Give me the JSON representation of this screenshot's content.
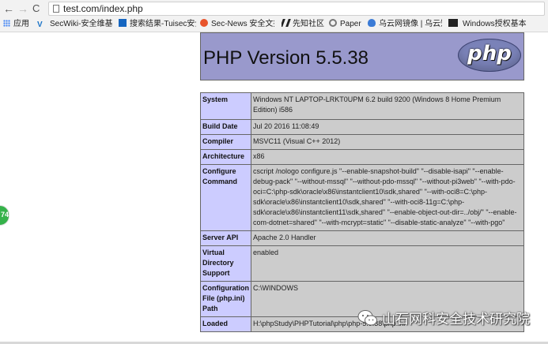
{
  "browser": {
    "url": "test.com/index.php",
    "nav": {
      "back": "←",
      "forward": "→",
      "reload": "C"
    }
  },
  "bookmarks": [
    {
      "label": "应用",
      "icon": "apps-icon",
      "color": "#4285f4"
    },
    {
      "label": "SecWiki-安全维基",
      "icon": "secwiki-icon",
      "color": "#1a73c7"
    },
    {
      "label": "搜索结果-Tuisec安全",
      "icon": "tuisec-icon",
      "color": "#1565c0"
    },
    {
      "label": "Sec-News 安全文摘",
      "icon": "secnews-icon",
      "color": "#e8532b"
    },
    {
      "label": "先知社区",
      "icon": "xianzhi-icon",
      "color": "#222222"
    },
    {
      "label": "Paper",
      "icon": "paper-icon",
      "color": "#666666"
    },
    {
      "label": "乌云网镜像 | 乌云知",
      "icon": "wooyun-icon",
      "color": "#3b7bd6"
    },
    {
      "label": "Windows授权基本",
      "icon": "windows-icon",
      "color": "#222222"
    }
  ],
  "php": {
    "version_title": "PHP Version 5.5.38",
    "logo_text": "php",
    "rows": [
      {
        "key": "System",
        "value": "Windows NT LAPTOP-LRKT0UPM 6.2 build 9200 (Windows 8 Home Premium Edition) i586"
      },
      {
        "key": "Build Date",
        "value": "Jul 20 2016 11:08:49"
      },
      {
        "key": "Compiler",
        "value": "MSVC11 (Visual C++ 2012)"
      },
      {
        "key": "Architecture",
        "value": "x86"
      },
      {
        "key": "Configure Command",
        "value": "cscript /nologo configure.js \"--enable-snapshot-build\" \"--disable-isapi\" \"--enable-debug-pack\" \"--without-mssql\" \"--without-pdo-mssql\" \"--without-pi3web\" \"--with-pdo-oci=C:\\php-sdk\\oracle\\x86\\instantclient10\\sdk,shared\" \"--with-oci8=C:\\php-sdk\\oracle\\x86\\instantclient10\\sdk,shared\" \"--with-oci8-11g=C:\\php-sdk\\oracle\\x86\\instantclient11\\sdk,shared\" \"--enable-object-out-dir=../obj/\" \"--enable-com-dotnet=shared\" \"--with-mcrypt=static\" \"--disable-static-analyze\" \"--with-pgo\""
      },
      {
        "key": "Server API",
        "value": "Apache 2.0 Handler"
      },
      {
        "key": "Virtual Directory Support",
        "value": "enabled"
      },
      {
        "key": "Configuration File (php.ini) Path",
        "value": "C:\\WINDOWS"
      },
      {
        "key": "Loaded",
        "value": "H:\\phpStudy\\PHPTutorial\\php\\php-5.5.38\\php.ini"
      }
    ]
  },
  "side_badge": {
    "label": "74",
    "color": "#35b24a"
  },
  "watermark": {
    "text": "山石网科安全技术研究院",
    "icon": "wechat-icon"
  },
  "colors": {
    "header_bg": "#9999cc",
    "key_bg": "#ccccff",
    "value_bg": "#cccccc"
  }
}
